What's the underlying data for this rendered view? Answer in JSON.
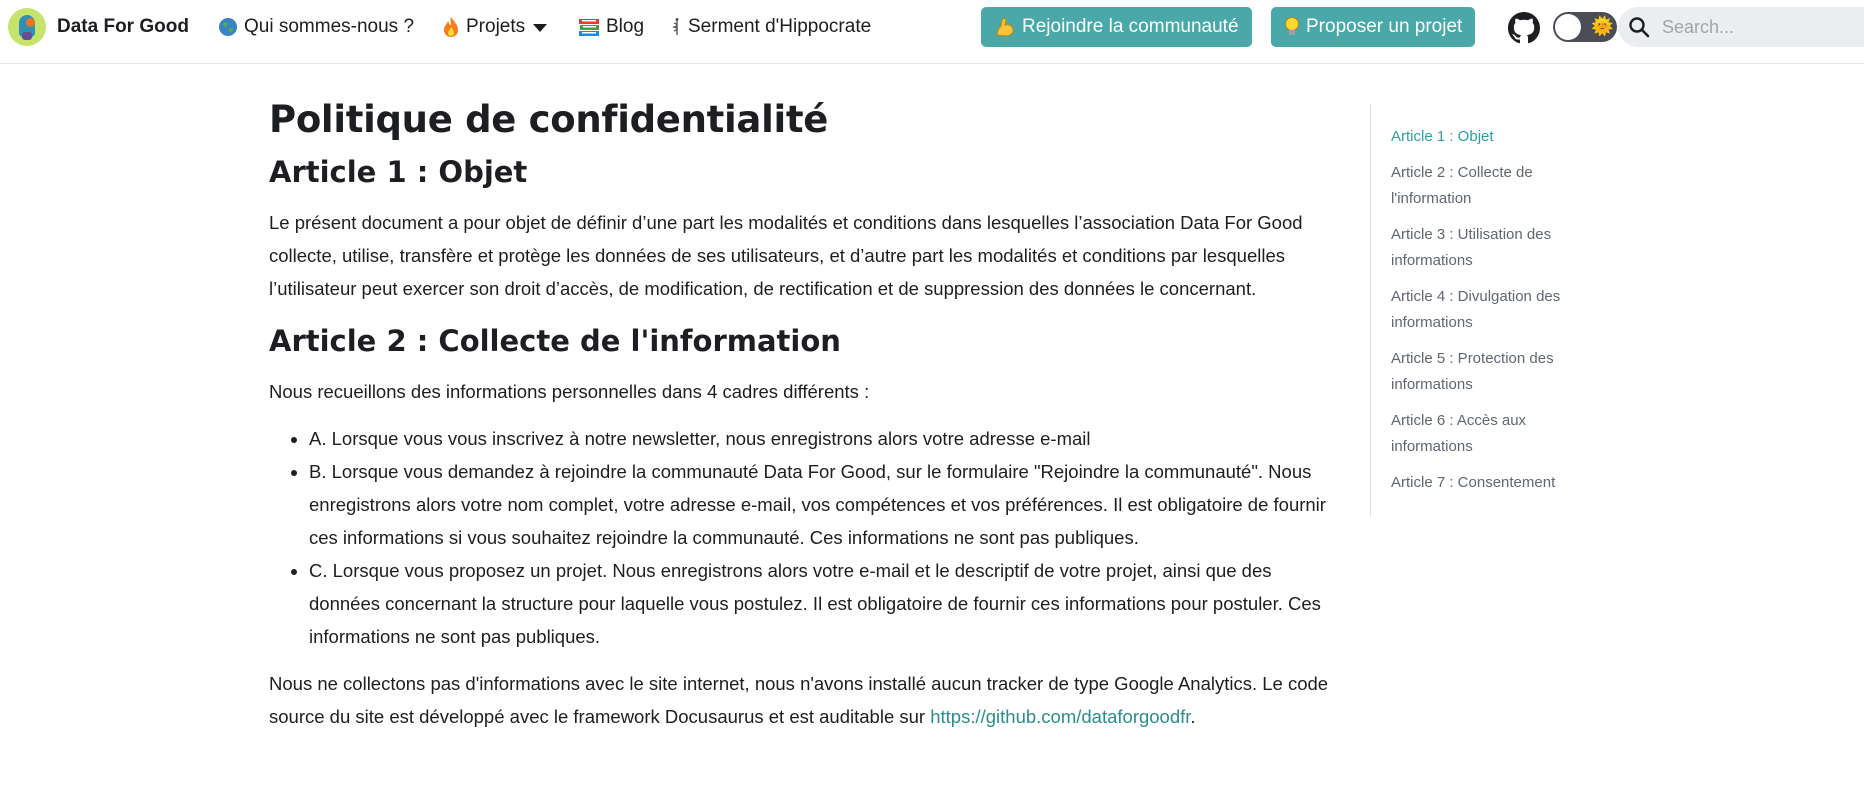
{
  "nav": {
    "brand": "Data For Good",
    "items": [
      {
        "label": "Qui sommes-nous ?",
        "icon": "globe-icon"
      },
      {
        "label": "Projets",
        "icon": "fire-icon"
      },
      {
        "label": "Blog",
        "icon": "books-icon"
      },
      {
        "label": "Serment d'Hippocrate",
        "icon": "caduceus-icon"
      }
    ],
    "join_button": "Rejoindre la communauté",
    "propose_button": "Proposer un projet",
    "search_placeholder": "Search..."
  },
  "article": {
    "title": "Politique de confidentialité",
    "a1_heading": "Article 1 : Objet",
    "a1_text": "Le présent document a pour objet de définir d’une part les modalités et conditions dans lesquelles l’association Data For Good collecte, utilise, transfère et protège les données de ses utilisateurs, et d’autre part les modalités et conditions par lesquelles l’utilisateur peut exercer son droit d’accès, de modification, de rectification et de suppression des données le concernant.",
    "a2_heading": "Article 2 : Collecte de l'information",
    "a2_intro": "Nous recueillons des informations personnelles dans 4 cadres différents :",
    "a2_list": [
      "A. Lorsque vous vous inscrivez à notre newsletter, nous enregistrons alors votre adresse e-mail",
      "B. Lorsque vous demandez à rejoindre la communauté Data For Good, sur le formulaire \"Rejoindre la communauté\". Nous enregistrons alors votre nom complet, votre adresse e-mail, vos compétences et vos préférences. Il est obligatoire de fournir ces informations si vous souhaitez rejoindre la communauté. Ces informations ne sont pas publiques.",
      "C. Lorsque vous proposez un projet. Nous enregistrons alors votre e-mail et le descriptif de votre projet, ainsi que des données concernant la structure pour laquelle vous postulez. Il est obligatoire de fournir ces informations pour postuler. Ces informations ne sont pas publiques."
    ],
    "a2_outro": "Nous ne collectons pas d'informations avec le site internet, nous n'avons installé aucun tracker de type Google Analytics. Le code source du site est développé avec le framework Docusaurus et est auditable sur ",
    "a2_link": "https://github.com/dataforgoodfr",
    "a2_outro_end": "."
  },
  "toc": [
    "Article 1 : Objet",
    "Article 2 : Collecte de l'information",
    "Article 3 : Utilisation des informations",
    "Article 4 : Divulgation des informations",
    "Article 5 : Protection des informations",
    "Article 6 : Accès aux informations",
    "Article 7 : Consentement"
  ],
  "colors": {
    "accent": "#4aa8a8",
    "link": "#2e8b8b",
    "toc_active": "#2e9e9e"
  }
}
